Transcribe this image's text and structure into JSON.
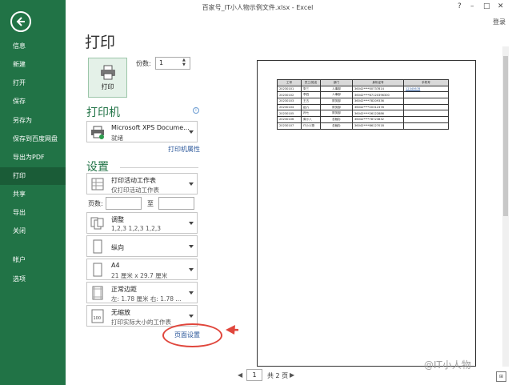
{
  "window": {
    "title": "百家号_IT小人物示例文件.xlsx - Excel",
    "help": "?",
    "minimize": "–",
    "restore": "□",
    "close": "✕",
    "signin": "登录"
  },
  "nav": {
    "items": [
      "信息",
      "新建",
      "打开",
      "保存",
      "另存为",
      "保存到百度网盘",
      "导出为PDF",
      "打印",
      "共享",
      "导出",
      "关闭",
      "帐户",
      "选项"
    ],
    "active": "打印"
  },
  "print": {
    "heading": "打印",
    "button_label": "打印",
    "copies_label": "份数:",
    "copies_value": "1"
  },
  "printer": {
    "section": "打印机",
    "name": "Microsoft XPS Docume...",
    "status": "就绪",
    "properties_link": "打印机属性",
    "info": "i"
  },
  "settings": {
    "section": "设置",
    "what": {
      "title": "打印活动工作表",
      "sub": "仅打印活动工作表"
    },
    "pages_label": "页数:",
    "to_label": "至",
    "collate": {
      "title": "调整",
      "sub": "1,2,3    1,2,3    1,2,3"
    },
    "orientation": {
      "title": "纵向"
    },
    "paper": {
      "title": "A4",
      "sub": "21 厘米 x 29.7 厘米"
    },
    "margins": {
      "title": "正常边距",
      "sub": "左: 1.78 厘米   右: 1.78 ..."
    },
    "scaling": {
      "title": "无缩放",
      "sub": "打印实际大小的工作表"
    },
    "page_setup_link": "页面设置"
  },
  "preview": {
    "headers": [
      "工号",
      "员工/姓名",
      "部门",
      "身份证号",
      "手机号"
    ],
    "rows": [
      [
        "20230101",
        "张三",
        "人事部",
        "36042****00737814",
        "12345678"
      ],
      [
        "20230102",
        "李四",
        "人事部",
        "36042****87120396300",
        ""
      ],
      [
        "20230103",
        "王五",
        "财务部",
        "36042****78209336",
        ""
      ],
      [
        "20230104",
        "赵六",
        "财务部",
        "36042****20312378",
        ""
      ],
      [
        "20230105",
        "孙七",
        "财务部",
        "36042****26122886",
        ""
      ],
      [
        "20230106",
        "周小八",
        "总裁办",
        "36042****78723832",
        ""
      ],
      [
        "20230107",
        "IT小人物",
        "总裁办",
        "36042****86127018",
        ""
      ]
    ]
  },
  "pagination": {
    "current": "1",
    "total": "共 2 页",
    "prev": "◀",
    "next": "▶"
  },
  "watermark": "@IT小人物",
  "colors": {
    "nav_bg": "#217346",
    "accent": "#217346",
    "link": "#2b579a",
    "annotation": "#e0463c"
  }
}
